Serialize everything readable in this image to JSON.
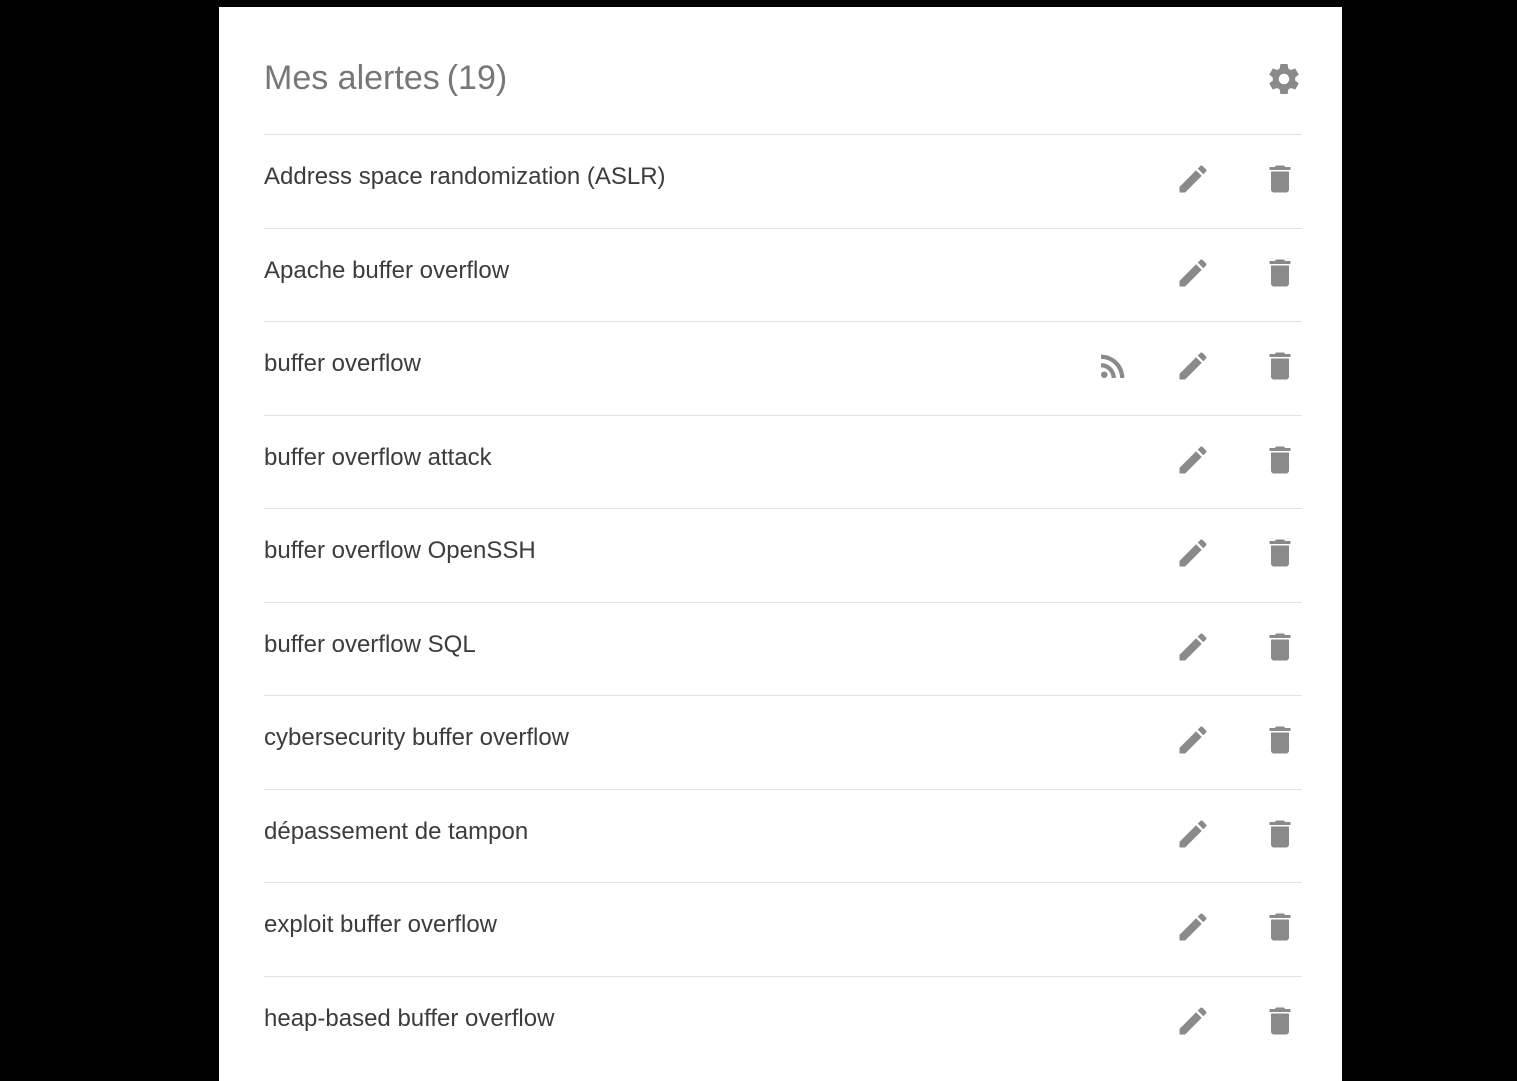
{
  "header": {
    "title": "Mes alertes",
    "count": "(19)",
    "settings_icon": "gear-icon"
  },
  "colors": {
    "icon": "#8a8a8a",
    "text": "#3c3c3c",
    "title": "#777777",
    "divider": "#e2e2e2"
  },
  "alerts": [
    {
      "label": "Address space randomization (ASLR)",
      "rss": false
    },
    {
      "label": "Apache buffer overflow",
      "rss": false
    },
    {
      "label": "buffer overflow",
      "rss": true
    },
    {
      "label": "buffer overflow attack",
      "rss": false
    },
    {
      "label": "buffer overflow OpenSSH",
      "rss": false
    },
    {
      "label": "buffer overflow SQL",
      "rss": false
    },
    {
      "label": "cybersecurity buffer overflow",
      "rss": false
    },
    {
      "label": "dépassement de tampon",
      "rss": false
    },
    {
      "label": "exploit buffer overflow",
      "rss": false
    },
    {
      "label": "heap-based buffer overflow",
      "rss": false
    }
  ],
  "row_icons": {
    "rss": "rss-feed-icon",
    "edit": "pencil-icon",
    "delete": "trash-icon"
  }
}
